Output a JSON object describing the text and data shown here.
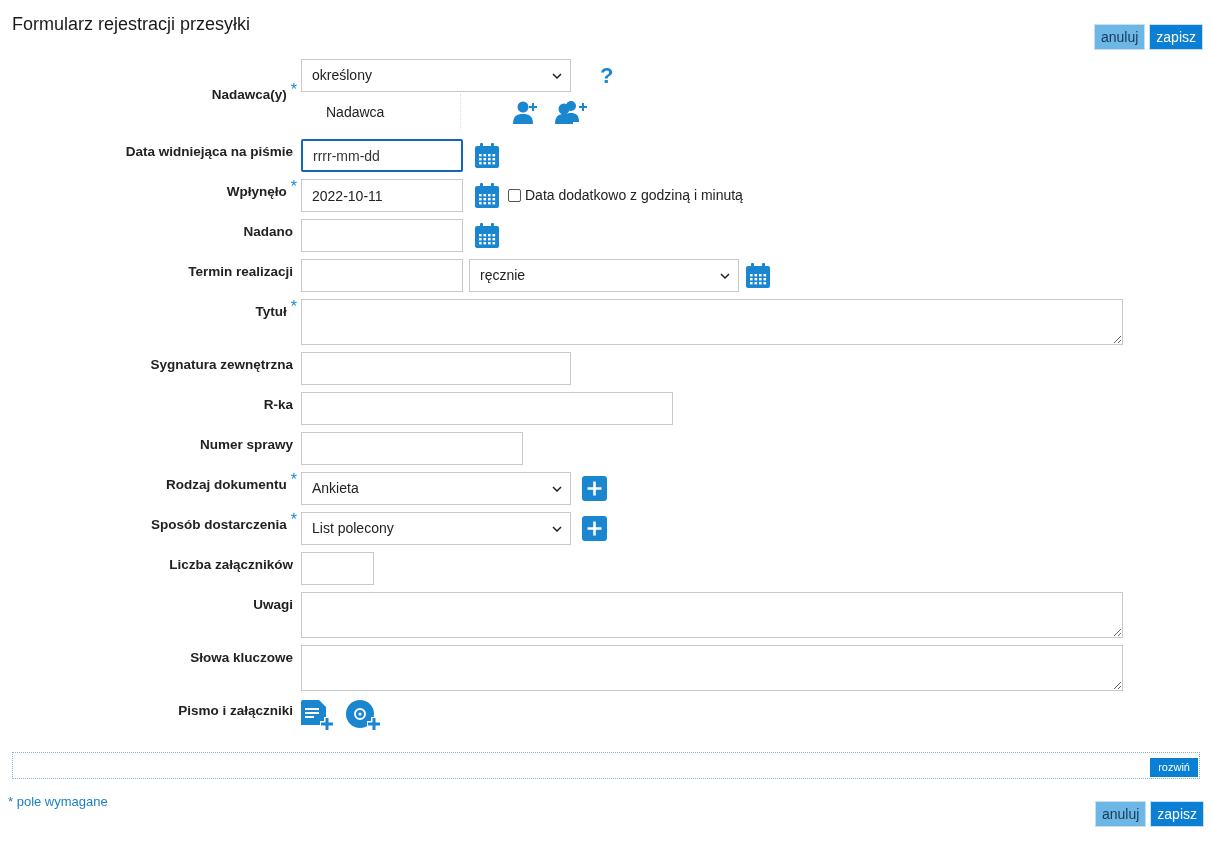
{
  "title": "Formularz rejestracji przesyłki",
  "top_buttons": [
    {
      "kind": "cancel",
      "label": "anuluj"
    },
    {
      "kind": "save",
      "label": "zapisz"
    }
  ],
  "fields": [
    {
      "kind": "sender",
      "label": "Nadawca(y)",
      "required_mark": "*",
      "select": "określony",
      "help": "?",
      "sender_column": "Nadawca"
    },
    {
      "kind": "date",
      "label": "Data widniejąca na piśmie",
      "placeholder": "rrrr-mm-dd",
      "focused": true
    },
    {
      "kind": "date",
      "label": "Wpłynęło",
      "required_mark": "*",
      "value": "2022-10-11",
      "focused": false,
      "checkbox": {
        "label": "Data dodatkowo z godziną i minutą",
        "checked": false
      }
    },
    {
      "kind": "date",
      "label": "Nadano",
      "focused": false
    },
    {
      "kind": "deadline",
      "label": "Termin realizacji",
      "select": "ręcznie",
      "focused": false
    },
    {
      "kind": "textarea",
      "label": "Tytuł",
      "required_mark": "*",
      "focused": false
    },
    {
      "kind": "text",
      "label": "Sygnatura zewnętrzna",
      "focused": false
    },
    {
      "kind": "text",
      "label": "R-ka",
      "focused": false
    },
    {
      "kind": "text",
      "label": "Numer sprawy",
      "focused": false
    },
    {
      "kind": "select-add",
      "label": "Rodzaj dokumentu",
      "required_mark": "*",
      "select": "Ankieta"
    },
    {
      "kind": "select-add",
      "label": "Sposób dostarczenia",
      "required_mark": "*",
      "select": "List polecony"
    },
    {
      "kind": "text",
      "label": "Liczba załączników",
      "focused": false
    },
    {
      "kind": "textarea",
      "label": "Uwagi",
      "focused": false
    },
    {
      "kind": "textarea",
      "label": "Słowa kluczowe",
      "focused": false
    },
    {
      "kind": "attachments",
      "label": "Pismo i załączniki"
    }
  ],
  "expand_button": "rozwiń",
  "required_note": "* pole wymagane",
  "bottom_buttons": [
    {
      "kind": "cancel",
      "label": "anuluj"
    },
    {
      "kind": "save",
      "label": "zapisz"
    }
  ]
}
